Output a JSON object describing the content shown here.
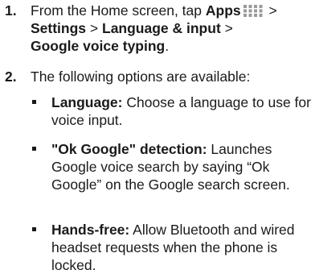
{
  "steps": [
    {
      "number": "1.",
      "parts": {
        "pre": "From the Home screen, tap ",
        "apps": "Apps",
        "sep1": " > ",
        "settings": "Settings",
        "sep2": " > ",
        "language_input": "Language & input",
        "sep3": " > ",
        "voice_typing": "Google voice typing",
        "end": "."
      },
      "icon": "apps-grid-icon"
    },
    {
      "number": "2.",
      "text": "The following options are available:"
    }
  ],
  "options": [
    {
      "term": "Language:",
      "desc": " Choose a language to use for voice input."
    },
    {
      "term": "\"Ok Google\" detection:",
      "desc": " Launches Google voice search by saying “Ok Google” on the Google search screen."
    },
    {
      "term": "Hands-free:",
      "desc": " Allow Bluetooth and wired headset requests when the phone is locked."
    }
  ],
  "colors": {
    "text": "#1a1a1a",
    "icon": "#9a9a9a"
  }
}
